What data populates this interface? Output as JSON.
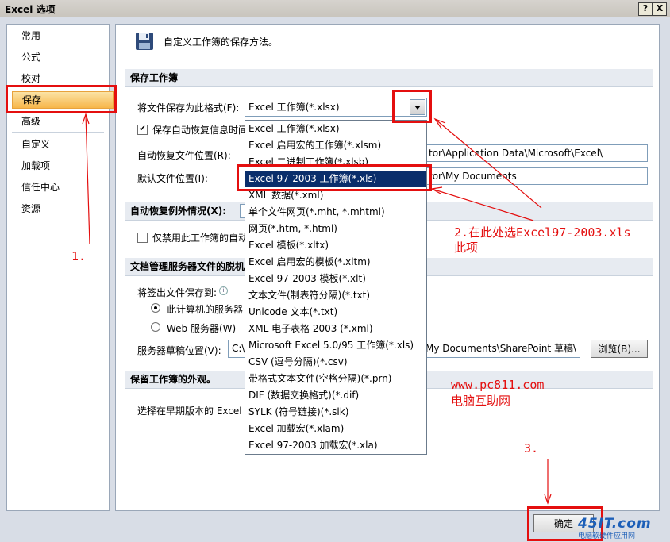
{
  "window": {
    "title": "Excel 选项",
    "help_btn": "?",
    "close_btn": "X"
  },
  "nav": {
    "items": [
      "常用",
      "公式",
      "校对",
      "保存",
      "高级",
      "自定义",
      "加载项",
      "信任中心",
      "资源"
    ],
    "selected": "保存"
  },
  "header": {
    "text": "自定义工作簿的保存方法。"
  },
  "sections": {
    "save": "保存工作簿",
    "autorecover_exceptions": "自动恢复例外情况(X):",
    "offline": "文档管理服务器文件的脱机",
    "preserve": "保留工作簿的外观。"
  },
  "fields": {
    "save_format_label": "将文件保存为此格式(F):",
    "save_format_value": "Excel 工作簿(*.xlsx)",
    "autosave_label": "保存自动恢复信息时间",
    "autorecover_loc_label": "自动恢复文件位置(R):",
    "autorecover_loc_value": "tor\\Application Data\\Microsoft\\Excel\\",
    "default_loc_label": "默认文件位置(I):",
    "default_loc_value": "tor\\My Documents",
    "disable_autorecover_label": "仅禁用此工作簿的自动",
    "checkout_label": "将签出文件保存到:",
    "radio_server": "此计算机的服务器",
    "radio_web": "Web 服务器(W)",
    "drafts_label": "服务器草稿位置(V):",
    "drafts_prefix": "C:\\",
    "drafts_value": "My Documents\\SharePoint 草稿\\",
    "browse_btn": "浏览(B)...",
    "preserve_label": "选择在早期版本的 Excel"
  },
  "dropdown": {
    "items": [
      "Excel 工作簿(*.xlsx)",
      "Excel 启用宏的工作簿(*.xlsm)",
      "Excel 二进制工作簿(*.xlsb)",
      "Excel 97-2003 工作簿(*.xls)",
      "XML 数据(*.xml)",
      "单个文件网页(*.mht, *.mhtml)",
      "网页(*.htm, *.html)",
      "Excel 模板(*.xltx)",
      "Excel 启用宏的模板(*.xltm)",
      "Excel 97-2003 模板(*.xlt)",
      "文本文件(制表符分隔)(*.txt)",
      "Unicode 文本(*.txt)",
      "XML 电子表格 2003 (*.xml)",
      "Microsoft Excel 5.0/95 工作簿(*.xls)",
      "CSV (逗号分隔)(*.csv)",
      "带格式文本文件(空格分隔)(*.prn)",
      "DIF (数据交换格式)(*.dif)",
      "SYLK (符号链接)(*.slk)",
      "Excel 加载宏(*.xlam)",
      "Excel 97-2003 加载宏(*.xla)"
    ],
    "highlighted": "Excel 97-2003 工作簿(*.xls)"
  },
  "annotations": {
    "step1": "1.",
    "step2": "2.在此处选Excel97-2003.xls",
    "step2b": "此项",
    "step3": "3.",
    "site_url": "www.pc811.com",
    "site_name": "电脑互助网"
  },
  "ok_btn": "确定",
  "logo": {
    "brand": "45IT.com",
    "tagline": "电脑软硬件应用网"
  },
  "colors": {
    "annotation_red": "#e40f0f",
    "selected_nav": "#f7b64a",
    "highlight": "#0a2e6b"
  }
}
